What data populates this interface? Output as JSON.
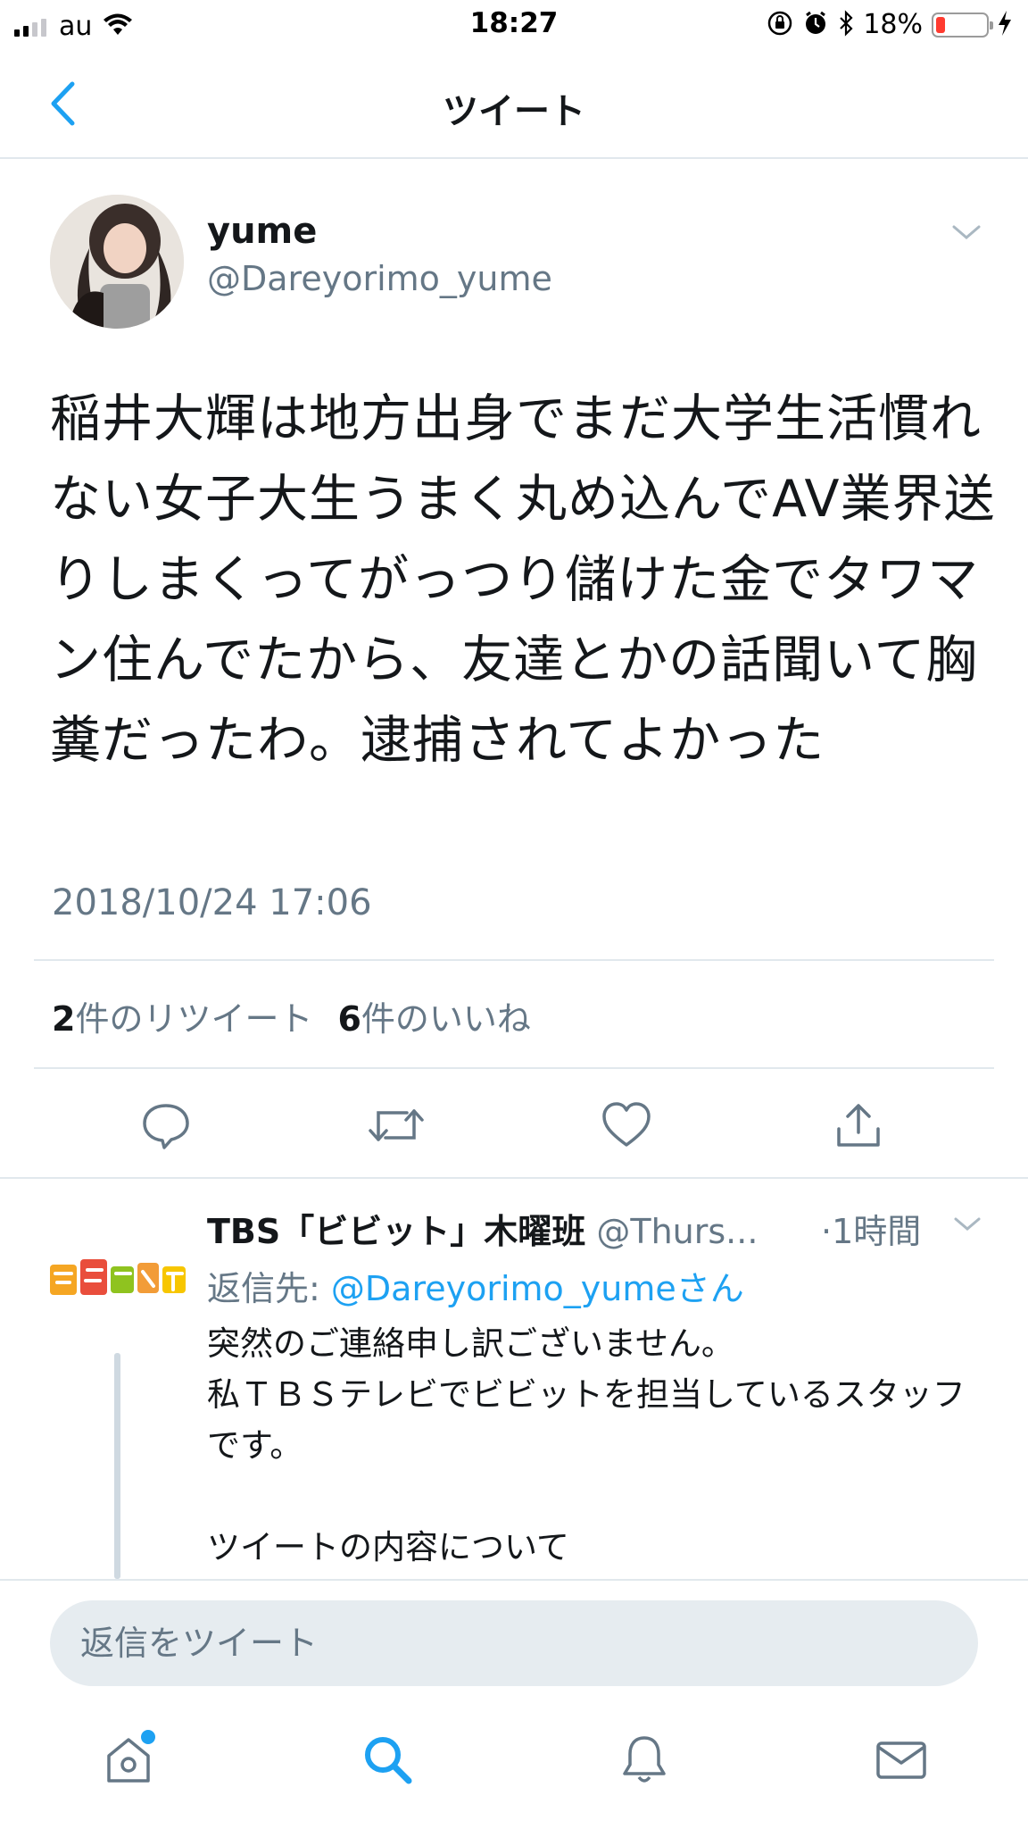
{
  "status_bar": {
    "carrier": "au",
    "time": "18:27",
    "battery_percent": "18%",
    "battery_level": 0.18,
    "signal_bars": 2
  },
  "nav": {
    "title": "ツイート",
    "back_icon": "chevron-left-icon"
  },
  "tweet": {
    "display_name": "yume",
    "handle": "@Dareyorimo_yume",
    "text": "稲井大輝は地方出身でまだ大学生活慣れない女子大生うまく丸め込んでAV業界送りしまくってがっつり儲けた金でタワマン住んでたから、友達とかの話聞いて胸糞だったわ。逮捕されてよかった",
    "timestamp": "2018/10/24 17:06",
    "retweet_count": "2",
    "retweet_label": "件のリツイート",
    "like_count": "6",
    "like_label": "件のいいね"
  },
  "actions": [
    "reply-icon",
    "retweet-icon",
    "like-icon",
    "share-icon"
  ],
  "reply": {
    "name": "TBS「ビビット」木曜班",
    "handle": "@Thurs...",
    "time": "·1時間",
    "reply_to_prefix": "返信先: ",
    "reply_to_mention": "@Dareyorimo_yumeさん",
    "body": [
      "突然のご連絡申し訳ございません。",
      "私ＴＢＳテレビでビビットを担当しているスタッフです。",
      "",
      "ツイートの内容について"
    ],
    "avatar_logo_colors": [
      "#f5a623",
      "#e94e3c",
      "#8fc31f",
      "#f29c38",
      "#f7c600"
    ]
  },
  "compose": {
    "placeholder": "返信をツイート"
  },
  "tabbar": {
    "tabs": [
      "home-icon",
      "search-icon",
      "notifications-icon",
      "messages-icon"
    ],
    "active": "search-icon"
  },
  "colors": {
    "accent": "#1da1f2",
    "secondary_text": "#657786",
    "divider": "#e1e8ed"
  }
}
